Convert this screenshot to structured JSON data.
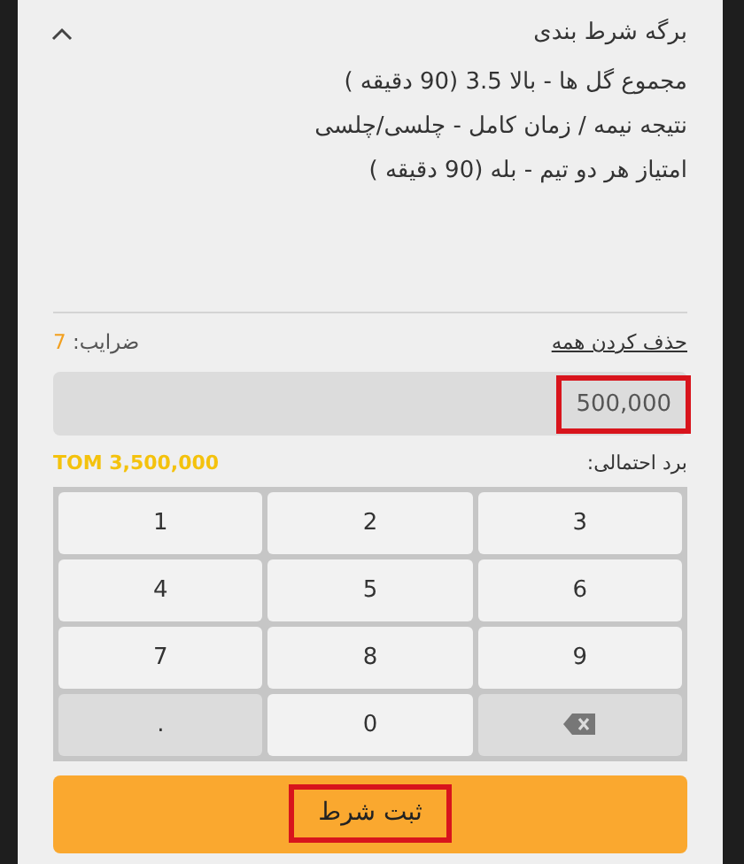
{
  "betslip": {
    "title": "برگه شرط بندی",
    "expanded": true,
    "selections": [
      "مجموع گل ها - بالا 3.5 (90 دقیقه )",
      "نتیجه نیمه / زمان کامل - چلسی/چلسی",
      "امتیاز هر دو تیم - بله (90 دقیقه )"
    ]
  },
  "clear_all": "حذف کردن همه",
  "odds": {
    "label": "ضرایب:",
    "value": "7"
  },
  "stake": {
    "value": "500,000",
    "highlighted": true
  },
  "potential_win": {
    "label": "برد احتمالی:",
    "value": "TOM 3,500,000"
  },
  "keypad": [
    {
      "kind": "digit",
      "label": "3"
    },
    {
      "kind": "digit",
      "label": "2"
    },
    {
      "kind": "digit",
      "label": "1"
    },
    {
      "kind": "digit",
      "label": "6"
    },
    {
      "kind": "digit",
      "label": "5"
    },
    {
      "kind": "digit",
      "label": "4"
    },
    {
      "kind": "digit",
      "label": "9"
    },
    {
      "kind": "digit",
      "label": "8"
    },
    {
      "kind": "digit",
      "label": "7"
    },
    {
      "kind": "backspace"
    },
    {
      "kind": "digit",
      "label": "0"
    },
    {
      "kind": "dot",
      "label": "."
    }
  ],
  "submit": {
    "label": "ثبت شرط",
    "highlighted": true
  }
}
